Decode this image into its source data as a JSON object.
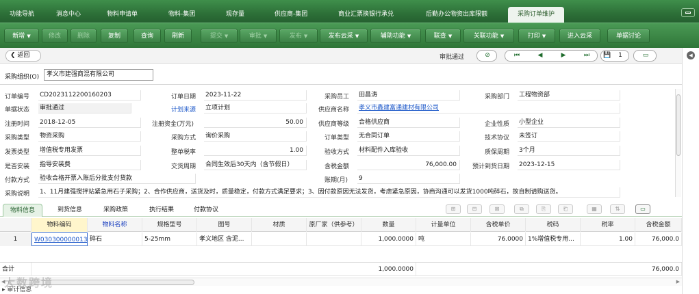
{
  "nav": {
    "tabs": [
      "功能导航",
      "消息中心",
      "物料申请单",
      "物料-集团",
      "现存量",
      "供应商-集团",
      "商业汇票换银行承兑",
      "后勤办公物资出库限额",
      "采购订单维护"
    ],
    "active_tab": "采购订单维护"
  },
  "toolbar": {
    "buttons": [
      {
        "label": "新增",
        "dropdown": true,
        "enabled": true
      },
      {
        "label": "修改",
        "dropdown": false,
        "enabled": false
      },
      {
        "label": "删除",
        "dropdown": false,
        "enabled": false
      },
      {
        "label": "复制",
        "dropdown": false,
        "enabled": true
      },
      {
        "label": "查询",
        "dropdown": false,
        "enabled": true
      },
      {
        "label": "刷新",
        "dropdown": false,
        "enabled": true
      },
      {
        "label": "提交",
        "dropdown": true,
        "enabled": false
      },
      {
        "label": "审批",
        "dropdown": true,
        "enabled": false
      },
      {
        "label": "发布",
        "dropdown": true,
        "enabled": false
      },
      {
        "label": "发布云采",
        "dropdown": true,
        "enabled": true
      },
      {
        "label": "辅助功能",
        "dropdown": true,
        "enabled": true
      },
      {
        "label": "联查",
        "dropdown": true,
        "enabled": true
      },
      {
        "label": "关联功能",
        "dropdown": true,
        "enabled": true
      },
      {
        "label": "打印",
        "dropdown": true,
        "enabled": true
      },
      {
        "label": "进入云采",
        "dropdown": false,
        "enabled": true
      },
      {
        "label": "单据讨论",
        "dropdown": false,
        "enabled": true
      }
    ]
  },
  "subheader": {
    "back_label": "返回",
    "approval_status": "审批通过",
    "page_number": "1"
  },
  "org": {
    "label": "采购组织(O)",
    "value": "孝义市建强商混有限公司"
  },
  "form": {
    "order_no": {
      "label": "订单编号",
      "value": "CD2023112200160203"
    },
    "doc_status": {
      "label": "单据状态",
      "value": "审批通过"
    },
    "reg_time": {
      "label": "注册时间",
      "value": "2018-12-05"
    },
    "purchase_type": {
      "label": "采购类型",
      "value": "物资采购"
    },
    "invoice_type": {
      "label": "发票类型",
      "value": "增值税专用发票"
    },
    "is_install": {
      "label": "是否安装",
      "value": "指导安装费"
    },
    "pay_method": {
      "label": "付款方式",
      "value": "验收合格开票入账后分批支付货款"
    },
    "order_date": {
      "label": "订单日期",
      "value": "2023-11-22"
    },
    "plan_source": {
      "label": "计划来源",
      "value": "立项计划"
    },
    "reg_capital": {
      "label": "注册资金(万元)",
      "value": "50.00"
    },
    "purchase_mode": {
      "label": "采购方式",
      "value": "询价采购"
    },
    "tax_rate_whole": {
      "label": "整单税率",
      "value": "1.00"
    },
    "delivery_cycle": {
      "label": "交货周期",
      "value": "合同生效后30天内（含节假日）"
    },
    "buyer": {
      "label": "采购员工",
      "value": "田昌涛"
    },
    "supplier_name": {
      "label": "供应商名称",
      "value": "孝义市鑫建富通建材有限公司"
    },
    "supplier_grade": {
      "label": "供应商等级",
      "value": "合格供应商"
    },
    "order_type": {
      "label": "订单类型",
      "value": "无合同订单"
    },
    "accept_mode": {
      "label": "验收方式",
      "value": "材料配件入库验收"
    },
    "tax_amount": {
      "label": "含税金额",
      "value": "76,000.00"
    },
    "account_period": {
      "label": "账期(月)",
      "value": "9"
    },
    "dept": {
      "label": "采购部门",
      "value": "工程物资部"
    },
    "enterprise_type": {
      "label": "企业性质",
      "value": "小型企业"
    },
    "tech_agreement": {
      "label": "技术协议",
      "value": "未签订"
    },
    "warranty": {
      "label": "质保周期",
      "value": "3个月"
    },
    "expected_arrival": {
      "label": "预计到货日期",
      "value": "2023-12-15"
    },
    "remark": {
      "label": "采购说明",
      "value": "1、11月建强搅拌站紧急用石子采购；2、合作供应商，送货及时，质量稳定，付款方式满足要求；3、因付款原因无法发货，考虑紧急原因，协商沟通可以发货1000吨碎石，故自制请购送货。"
    }
  },
  "detail_tabs": [
    "物料信息",
    "到货信息",
    "采购政策",
    "执行结果",
    "付款协议"
  ],
  "detail_active": "物料信息",
  "grid": {
    "headers": [
      "物料编码",
      "物料名称",
      "规格型号",
      "图号",
      "材质",
      "原厂家（供参考）",
      "数量",
      "计量单位",
      "含税单价",
      "税码",
      "税率",
      "含税金额"
    ],
    "rows": [
      {
        "index": "1",
        "code": "W030300000013",
        "name": "碎石",
        "spec": "5-25mm",
        "drawing": "孝义地区 含泥...",
        "material": "",
        "manufacturer": "",
        "qty": "1,000.0000",
        "unit": "吨",
        "unit_price": "76.0000",
        "tax_code": "1%增值税专用...",
        "tax_rate": "1.00",
        "amount": "76,000.0"
      }
    ],
    "total_label": "合计",
    "total_qty": "1,000.0000",
    "total_amount": "76,000.0"
  },
  "watermark": "大数跨境",
  "audit_label": "审计信息"
}
